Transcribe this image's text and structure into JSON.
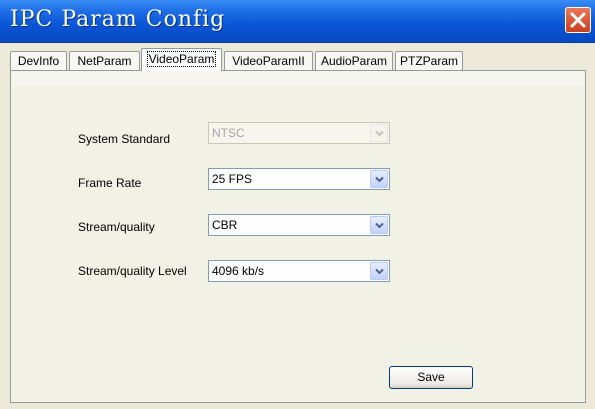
{
  "window": {
    "title": "IPC Param Config"
  },
  "tabs": [
    {
      "label": "DevInfo"
    },
    {
      "label": "NetParam"
    },
    {
      "label": "VideoParam",
      "active": true
    },
    {
      "label": "VideoParamII"
    },
    {
      "label": "AudioParam"
    },
    {
      "label": "PTZParam"
    }
  ],
  "form": {
    "system_standard": {
      "label": "System Standard",
      "value": "NTSC",
      "disabled": true
    },
    "frame_rate": {
      "label": "Frame Rate",
      "value": "25 FPS"
    },
    "stream_quality": {
      "label": "Stream/quality",
      "value": "CBR"
    },
    "stream_quality_level": {
      "label": "Stream/quality Level",
      "value": "4096 kb/s"
    }
  },
  "buttons": {
    "save": "Save"
  },
  "colors": {
    "titlebar": "#0a55d6",
    "close": "#c8401c",
    "panel": "#f2f1e6"
  }
}
